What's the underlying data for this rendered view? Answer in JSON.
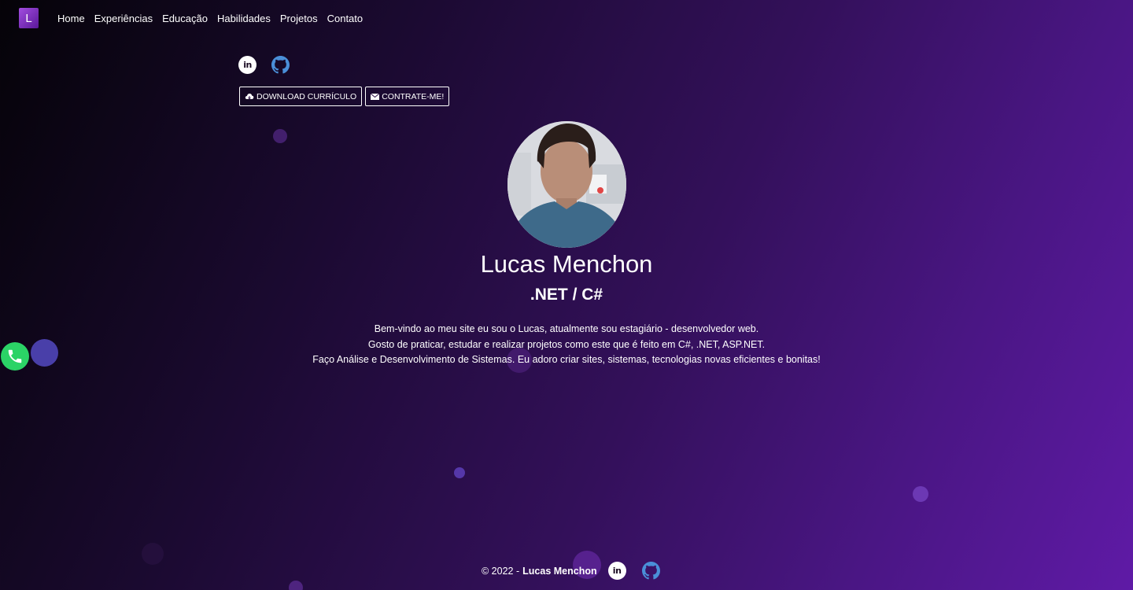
{
  "brand": {
    "letter": "L"
  },
  "nav": {
    "items": [
      "Home",
      "Experiências",
      "Educação",
      "Habilidades",
      "Projetos",
      "Contato"
    ]
  },
  "social": {
    "linkedin_icon": "linkedin-icon",
    "github_icon": "github-icon",
    "linkedin_glyph": "in"
  },
  "buttons": {
    "download": "DOWNLOAD CURRÍCULO",
    "hire": "CONTRATE-ME!"
  },
  "hero": {
    "name": "Lucas Menchon",
    "role": ".NET / C#",
    "intro": [
      "Bem-vindo ao meu site eu sou o Lucas, atualmente sou estagiário - desenvolvedor web.",
      "Gosto de praticar, estudar e realizar projetos como este que é feito em C#, .NET, ASP.NET.",
      "Faço Análise e Desenvolvimento de Sistemas. Eu adoro criar sites, sistemas, tecnologias novas eficientes e bonitas!"
    ]
  },
  "footer": {
    "copyright": "© 2022 -",
    "author": "Lucas Menchon"
  },
  "colors": {
    "whatsapp": "#2bd366",
    "github": "#4a8fd8",
    "bubble": "#4e44a8"
  }
}
